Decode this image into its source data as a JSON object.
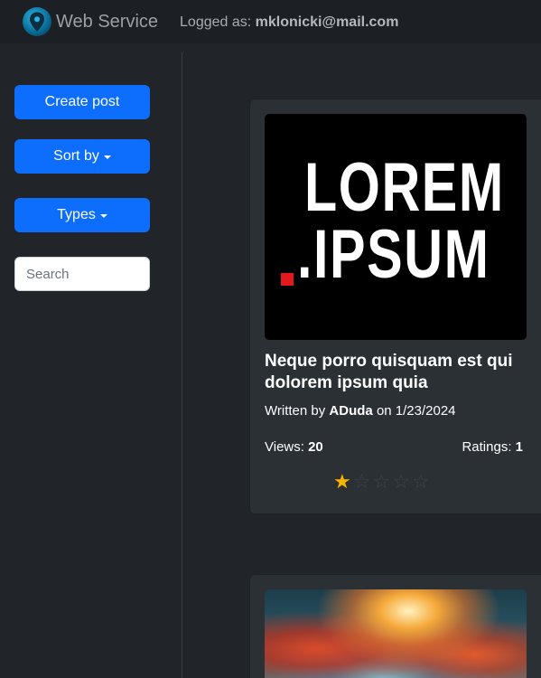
{
  "navbar": {
    "brand": "Web Service",
    "logged_prefix": "Logged as:",
    "user_email": "mklonicki@mail.com"
  },
  "sidebar": {
    "create_post": "Create post",
    "sort_by": "Sort by",
    "types": "Types",
    "search_placeholder": "Search"
  },
  "posts": [
    {
      "image_text_line1": "LOREM",
      "image_text_line2": ".IPSUM",
      "title": "Neque porro quisquam est qui dolorem ipsum quia",
      "written_by": "Written by",
      "author": "ADuda",
      "date_prefix": "on",
      "date": "1/23/2024",
      "views_label": "Views:",
      "views": "20",
      "ratings_label": "Ratings:",
      "ratings": "1",
      "stars": 1,
      "max_stars": 5
    }
  ],
  "colors": {
    "primary": "#0d6efd",
    "star": "#f7b500",
    "background": "#212529",
    "card": "#2b3035"
  }
}
